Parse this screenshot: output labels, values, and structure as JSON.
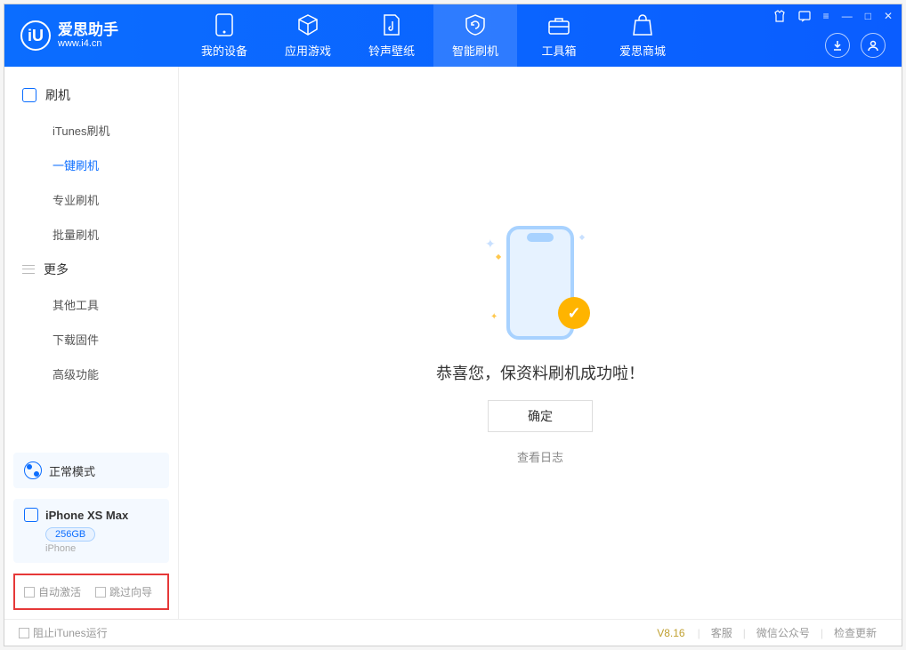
{
  "header": {
    "logo_cn": "爱思助手",
    "logo_url": "www.i4.cn",
    "tabs": [
      {
        "label": "我的设备"
      },
      {
        "label": "应用游戏"
      },
      {
        "label": "铃声壁纸"
      },
      {
        "label": "智能刷机"
      },
      {
        "label": "工具箱"
      },
      {
        "label": "爱思商城"
      }
    ],
    "active_tab_index": 3
  },
  "sidebar": {
    "group1_label": "刷机",
    "items1": [
      {
        "label": "iTunes刷机"
      },
      {
        "label": "一键刷机"
      },
      {
        "label": "专业刷机"
      },
      {
        "label": "批量刷机"
      }
    ],
    "active1_index": 1,
    "group2_label": "更多",
    "items2": [
      {
        "label": "其他工具"
      },
      {
        "label": "下载固件"
      },
      {
        "label": "高级功能"
      }
    ],
    "mode": "正常模式",
    "device": {
      "name": "iPhone XS Max",
      "storage": "256GB",
      "type": "iPhone"
    },
    "checkboxes": {
      "auto_activate": "自动激活",
      "skip_guide": "跳过向导"
    }
  },
  "main": {
    "success_text": "恭喜您，保资料刷机成功啦！",
    "ok_button": "确定",
    "view_log": "查看日志"
  },
  "footer": {
    "block_itunes": "阻止iTunes运行",
    "version": "V8.16",
    "links": [
      {
        "label": "客服"
      },
      {
        "label": "微信公众号"
      },
      {
        "label": "检查更新"
      }
    ]
  }
}
